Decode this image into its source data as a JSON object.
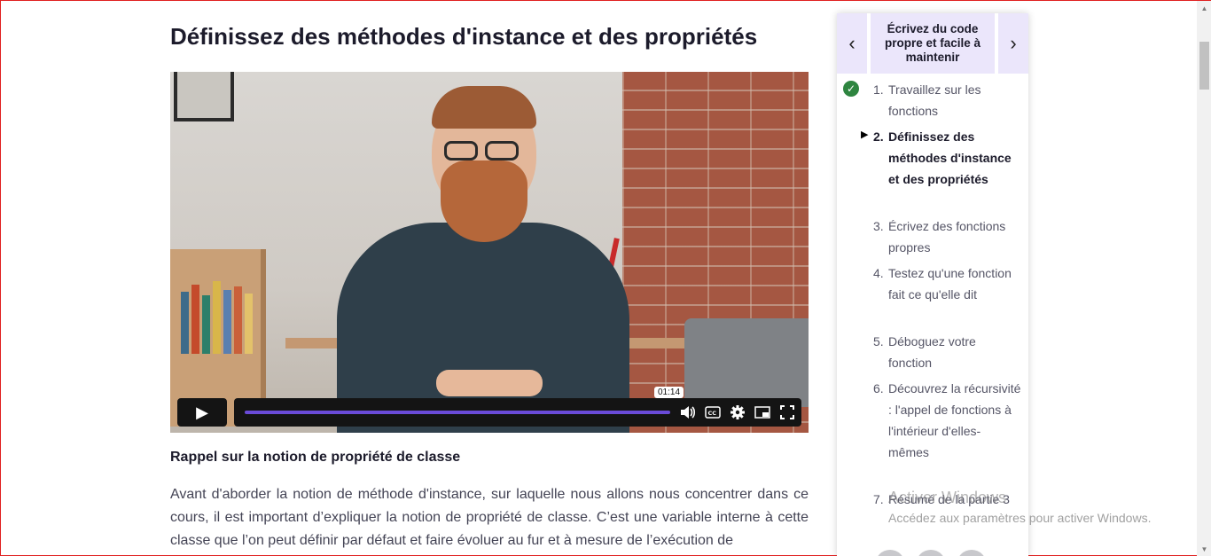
{
  "page": {
    "title": "Définissez des méthodes d'instance et des propriétés"
  },
  "video": {
    "time_tooltip": "01:14",
    "progress": 0.995,
    "play_icon": "play-icon",
    "icons": [
      "volume-icon",
      "captions-icon",
      "settings-icon",
      "picture-in-picture-icon",
      "fullscreen-icon"
    ]
  },
  "content": {
    "section_heading": "Rappel sur la notion de propriété de classe",
    "paragraph": "Avant d'aborder la notion de méthode d'instance, sur laquelle nous allons nous concentrer dans ce cours, il est important d’expliquer la notion de propriété de classe. C’est une variable interne à cette classe que l’on peut définir par défaut et faire évoluer au fur et à mesure de l’exécution de"
  },
  "sidebar": {
    "prev_icon": "chevron-left-icon",
    "next_icon": "chevron-right-icon",
    "chapter_title": "Écrivez du code propre et facile à maintenir",
    "items": [
      {
        "num": "1.",
        "label": "Travaillez sur les fonctions",
        "completed": true
      },
      {
        "num": "2.",
        "label": "Définissez des méthodes d'instance et des propriétés",
        "current": true
      },
      {
        "num": "3.",
        "label": "Écrivez des fonctions propres"
      },
      {
        "num": "4.",
        "label": "Testez qu'une fonction fait ce qu'elle dit"
      },
      {
        "num": "5.",
        "label": "Déboguez votre fonction"
      },
      {
        "num": "6.",
        "label": "Découvrez la récursivité : l'appel de fonctions à l'intérieur d'elles-mêmes"
      },
      {
        "num": "7.",
        "label": "Résumé de la partie 3"
      }
    ]
  },
  "windows_watermark": {
    "line1": "Activer Windows",
    "line2": "Accédez aux paramètres pour activer Windows."
  },
  "colors": {
    "accent": "#6a4bd8",
    "sidebar_header_bg": "#ebe6fb",
    "completed_green": "#2e8540",
    "border": "#e02020"
  }
}
